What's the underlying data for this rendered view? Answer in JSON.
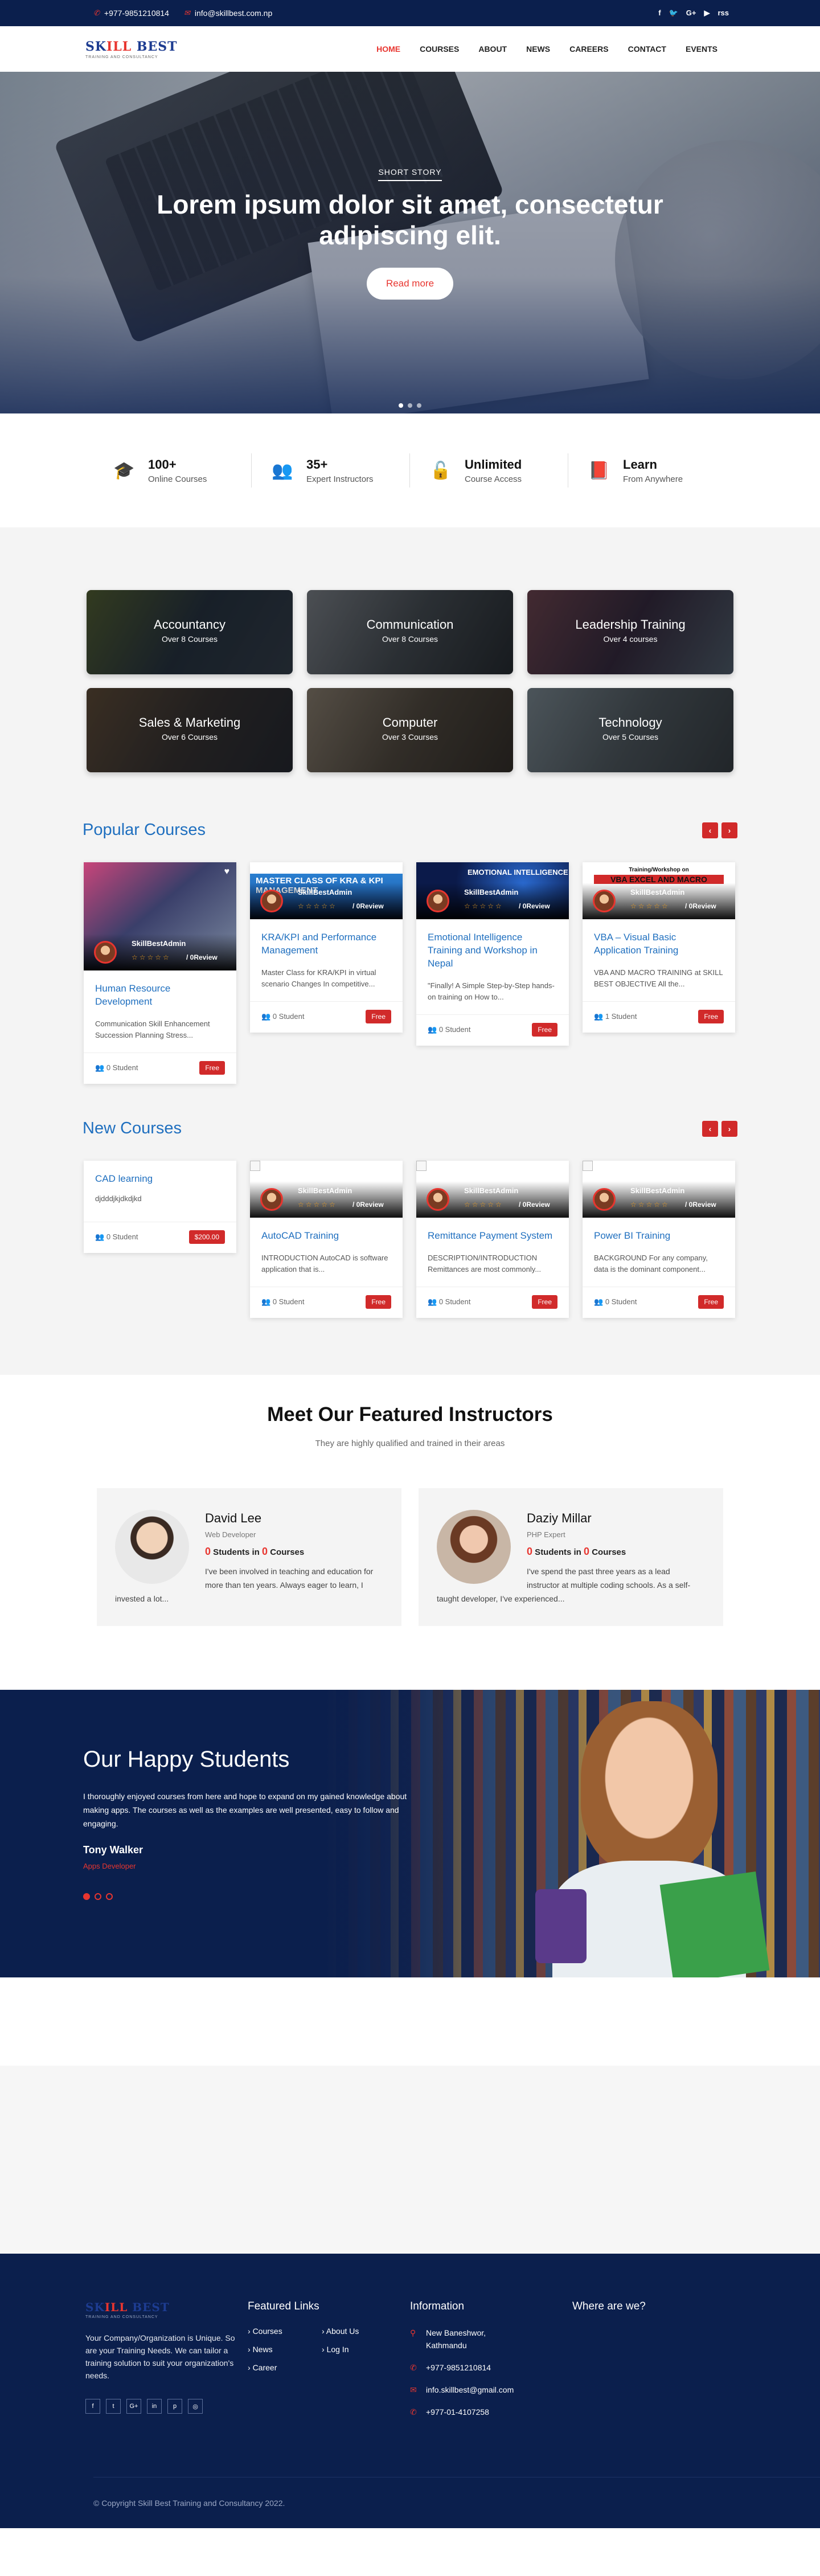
{
  "topbar": {
    "phone": "+977-9851210814",
    "email": "info@skillbest.com.np",
    "social": [
      "f",
      "🐦",
      "G+",
      "▶",
      "rss"
    ]
  },
  "logo": {
    "part1": "SK",
    "part2": "ILL",
    "part3": " BEST",
    "sub": "TRAINING AND CONSULTANCY"
  },
  "nav": {
    "items": [
      "HOME",
      "COURSES",
      "ABOUT",
      "NEWS",
      "CAREERS",
      "CONTACT",
      "EVENTS"
    ]
  },
  "hero": {
    "kicker": "SHORT STORY",
    "title": "Lorem ipsum dolor sit amet, consectetur adipiscing elit.",
    "button": "Read more"
  },
  "features": [
    {
      "icon": "graduation-cap-icon",
      "title": "100+",
      "sub": "Online Courses"
    },
    {
      "icon": "users-icon",
      "title": "35+",
      "sub": "Expert Instructors"
    },
    {
      "icon": "unlock-icon",
      "title": "Unlimited",
      "sub": "Course Access"
    },
    {
      "icon": "book-icon",
      "title": "Learn",
      "sub": "From Anywhere"
    }
  ],
  "categories": [
    {
      "name": "Accountancy",
      "sub": "Over 8 Courses"
    },
    {
      "name": "Communication",
      "sub": "Over 8 Courses"
    },
    {
      "name": "Leadership Training",
      "sub": "Over 4 courses"
    },
    {
      "name": "Sales & Marketing",
      "sub": "Over 6 Courses"
    },
    {
      "name": "Computer",
      "sub": "Over 3 Courses"
    },
    {
      "name": "Technology",
      "sub": "Over 5 Courses"
    }
  ],
  "popular": {
    "heading": "Popular Courses",
    "courses": [
      {
        "title": "Human Resource Development",
        "desc": "Communication Skill Enhancement Succession Planning Stress...",
        "students": "0 Student",
        "price": "Free",
        "admin": "SkillBestAdmin",
        "rating": "0Review"
      },
      {
        "title": "KRA/KPI and Performance Management",
        "desc": "Master Class for KRA/KPI in virtual scenario Changes In competitive...",
        "students": "0 Student",
        "price": "Free",
        "admin": "SkillBestAdmin",
        "rating": "0Review",
        "banner": "MASTER CLASS OF KRA & KPI MANAGEMENT"
      },
      {
        "title": "Emotional Intelligence Training and Workshop in Nepal",
        "desc": "\"Finally! A Simple Step-by-Step hands-on training on How to...",
        "students": "0 Student",
        "price": "Free",
        "admin": "SkillBestAdmin",
        "rating": "0Review",
        "banner": "EMOTIONAL INTELLIGENCE"
      },
      {
        "title": "VBA – Visual Basic Application Training",
        "desc": "VBA AND MACRO TRAINING at SKILL BEST OBJECTIVE All the...",
        "students": "1 Student",
        "price": "Free",
        "admin": "SkillBestAdmin",
        "rating": "0Review",
        "banner": "VBA EXCEL AND MACRO",
        "banner_top": "Training/Workshop on"
      }
    ]
  },
  "newc": {
    "heading": "New Courses",
    "courses": [
      {
        "title": "CAD learning",
        "desc": "djdddjkjdkdjkd",
        "students": "0 Student",
        "price": "$200.00"
      },
      {
        "title": "AutoCAD Training",
        "desc": "INTRODUCTION AutoCAD is software application that is...",
        "students": "0 Student",
        "price": "Free",
        "admin": "SkillBestAdmin",
        "rating": "0Review"
      },
      {
        "title": "Remittance Payment System",
        "desc": "DESCRIPTION/INTRODUCTION Remittances are most commonly...",
        "students": "0 Student",
        "price": "Free",
        "admin": "SkillBestAdmin",
        "rating": "0Review"
      },
      {
        "title": "Power BI Training",
        "desc": "BACKGROUND For any company, data is the dominant component...",
        "students": "0 Student",
        "price": "Free",
        "admin": "SkillBestAdmin",
        "rating": "0Review"
      }
    ]
  },
  "instructors": {
    "heading": "Meet Our Featured Instructors",
    "sub": "They are highly qualified and trained in their areas",
    "list": [
      {
        "name": "David Lee",
        "role": "Web Developer",
        "n1": "0",
        "t1": " Students in ",
        "n2": "0",
        "t2": " Courses",
        "bio": "I've been involved in teaching and education for more than ten years. Always eager to learn, I invested a lot..."
      },
      {
        "name": "Daziy Millar",
        "role": "PHP Expert",
        "n1": "0",
        "t1": " Students in ",
        "n2": "0",
        "t2": " Courses",
        "bio": "I've spend the past three years as a lead instructor at multiple coding schools. As a self-taught developer, I've experienced..."
      }
    ]
  },
  "students": {
    "heading": "Our Happy Students",
    "quote": "I thoroughly enjoyed courses from here and hope to expand on my gained knowledge about making apps. The courses as well as the examples are well presented, easy to follow and engaging.",
    "name": "Tony Walker",
    "role": "Apps Developer"
  },
  "footer": {
    "about": "Your Company/Organization is Unique. So are your Training Needs. We can tailor a training solution to suit your organization's needs.",
    "links_title": "Featured Links",
    "links": [
      "Courses",
      "About Us",
      "News",
      "Log In",
      "Career"
    ],
    "info_title": "Information",
    "address": "New Baneshwor, Kathmandu",
    "phone": "+977-9851210814",
    "email": "info.skillbest@gmail.com",
    "tel": "+977-01-4107258",
    "where_title": "Where are we?",
    "social": [
      "f",
      "t",
      "G+",
      "in",
      "p",
      "◎"
    ],
    "copyright": "© Copyright Skill Best Training and Consultancy 2022."
  },
  "colors": {
    "navy": "#0b1f4d",
    "accent": "#e8352f",
    "link": "#1f6fbf"
  }
}
